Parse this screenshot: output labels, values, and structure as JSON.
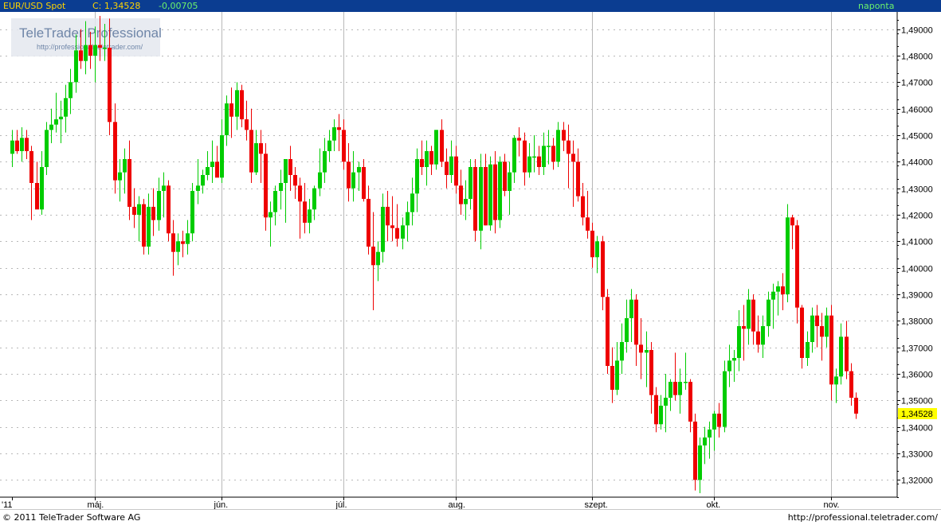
{
  "header": {
    "symbol": "EUR/USD Spot",
    "close_label": "C: 1,34528",
    "change": "-0,00705",
    "period": "naponta"
  },
  "watermark": {
    "title": "TeleTrader Professional",
    "url": "http://professional.teletrader.com/"
  },
  "footer": {
    "copyright": "© 2011 TeleTrader Software AG",
    "site": "http://professional.teletrader.com/"
  },
  "colors": {
    "up": "#00cc00",
    "down": "#ee0000",
    "header_bg": "#0b3d91",
    "last_price_bg": "#ffff00"
  },
  "chart_data": {
    "type": "candlestick",
    "title": "EUR/USD Spot",
    "yaxis_position": "right",
    "ylim": [
      1.3135,
      1.4965
    ],
    "y_ticks": [
      1.32,
      1.33,
      1.34,
      1.35,
      1.36,
      1.37,
      1.38,
      1.39,
      1.4,
      1.41,
      1.42,
      1.43,
      1.44,
      1.45,
      1.46,
      1.47,
      1.48,
      1.49
    ],
    "y_tick_labels": [
      "1,32000",
      "1,33000",
      "1,34000",
      "1,35000",
      "1,36000",
      "1,37000",
      "1,38000",
      "1,39000",
      "1,40000",
      "1,41000",
      "1,42000",
      "1,43000",
      "1,44000",
      "1,45000",
      "1,46000",
      "1,47000",
      "1,48000",
      "1,49000"
    ],
    "x_months": [
      {
        "label": "'11",
        "index": 0
      },
      {
        "label": "máj.",
        "index": 17
      },
      {
        "label": "jún.",
        "index": 43
      },
      {
        "label": "júl.",
        "index": 68
      },
      {
        "label": "aug.",
        "index": 91
      },
      {
        "label": "szept.",
        "index": 119
      },
      {
        "label": "okt.",
        "index": 144
      },
      {
        "label": "nov.",
        "index": 168
      }
    ],
    "last_price": "1,34528",
    "candles": [
      [
        1.443,
        1.452,
        1.438,
        1.448
      ],
      [
        1.448,
        1.452,
        1.443,
        1.444
      ],
      [
        1.444,
        1.453,
        1.44,
        1.449
      ],
      [
        1.449,
        1.452,
        1.441,
        1.444
      ],
      [
        1.444,
        1.446,
        1.418,
        1.432
      ],
      [
        1.432,
        1.44,
        1.425,
        1.422
      ],
      [
        1.422,
        1.444,
        1.42,
        1.438
      ],
      [
        1.438,
        1.455,
        1.435,
        1.452
      ],
      [
        1.452,
        1.46,
        1.447,
        1.454
      ],
      [
        1.454,
        1.466,
        1.451,
        1.456
      ],
      [
        1.456,
        1.463,
        1.447,
        1.457
      ],
      [
        1.457,
        1.469,
        1.451,
        1.464
      ],
      [
        1.464,
        1.475,
        1.458,
        1.47
      ],
      [
        1.47,
        1.488,
        1.466,
        1.482
      ],
      [
        1.482,
        1.49,
        1.475,
        1.478
      ],
      [
        1.478,
        1.493,
        1.473,
        1.484
      ],
      [
        1.484,
        1.489,
        1.475,
        1.48
      ],
      [
        1.48,
        1.491,
        1.47,
        1.484
      ],
      [
        1.484,
        1.495,
        1.478,
        1.483
      ],
      [
        1.483,
        1.492,
        1.478,
        1.483
      ],
      [
        1.483,
        1.494,
        1.45,
        1.455
      ],
      [
        1.455,
        1.462,
        1.428,
        1.433
      ],
      [
        1.433,
        1.441,
        1.425,
        1.436
      ],
      [
        1.436,
        1.445,
        1.428,
        1.441
      ],
      [
        1.441,
        1.448,
        1.418,
        1.423
      ],
      [
        1.423,
        1.43,
        1.415,
        1.42
      ],
      [
        1.42,
        1.427,
        1.41,
        1.424
      ],
      [
        1.424,
        1.426,
        1.405,
        1.408
      ],
      [
        1.408,
        1.428,
        1.405,
        1.423
      ],
      [
        1.423,
        1.43,
        1.412,
        1.418
      ],
      [
        1.418,
        1.434,
        1.414,
        1.429
      ],
      [
        1.429,
        1.436,
        1.419,
        1.431
      ],
      [
        1.431,
        1.433,
        1.41,
        1.413
      ],
      [
        1.413,
        1.418,
        1.397,
        1.406
      ],
      [
        1.406,
        1.413,
        1.401,
        1.41
      ],
      [
        1.41,
        1.414,
        1.404,
        1.409
      ],
      [
        1.409,
        1.418,
        1.405,
        1.413
      ],
      [
        1.413,
        1.432,
        1.41,
        1.429
      ],
      [
        1.429,
        1.441,
        1.424,
        1.431
      ],
      [
        1.431,
        1.437,
        1.428,
        1.435
      ],
      [
        1.435,
        1.444,
        1.433,
        1.438
      ],
      [
        1.438,
        1.448,
        1.432,
        1.44
      ],
      [
        1.44,
        1.446,
        1.435,
        1.434
      ],
      [
        1.434,
        1.456,
        1.432,
        1.45
      ],
      [
        1.45,
        1.465,
        1.446,
        1.462
      ],
      [
        1.462,
        1.468,
        1.449,
        1.457
      ],
      [
        1.457,
        1.47,
        1.452,
        1.467
      ],
      [
        1.467,
        1.469,
        1.453,
        1.456
      ],
      [
        1.456,
        1.463,
        1.448,
        1.452
      ],
      [
        1.452,
        1.46,
        1.432,
        1.436
      ],
      [
        1.436,
        1.452,
        1.435,
        1.447
      ],
      [
        1.447,
        1.452,
        1.432,
        1.443
      ],
      [
        1.443,
        1.447,
        1.414,
        1.419
      ],
      [
        1.419,
        1.425,
        1.408,
        1.421
      ],
      [
        1.421,
        1.431,
        1.416,
        1.429
      ],
      [
        1.429,
        1.437,
        1.422,
        1.432
      ],
      [
        1.432,
        1.44,
        1.417,
        1.441
      ],
      [
        1.441,
        1.446,
        1.429,
        1.435
      ],
      [
        1.435,
        1.438,
        1.426,
        1.431
      ],
      [
        1.431,
        1.434,
        1.411,
        1.425
      ],
      [
        1.425,
        1.432,
        1.413,
        1.417
      ],
      [
        1.417,
        1.426,
        1.413,
        1.422
      ],
      [
        1.422,
        1.431,
        1.418,
        1.43
      ],
      [
        1.43,
        1.445,
        1.427,
        1.436
      ],
      [
        1.436,
        1.449,
        1.432,
        1.444
      ],
      [
        1.444,
        1.452,
        1.44,
        1.448
      ],
      [
        1.448,
        1.456,
        1.444,
        1.453
      ],
      [
        1.453,
        1.458,
        1.444,
        1.452
      ],
      [
        1.452,
        1.456,
        1.437,
        1.44
      ],
      [
        1.44,
        1.447,
        1.425,
        1.43
      ],
      [
        1.43,
        1.444,
        1.425,
        1.436
      ],
      [
        1.436,
        1.44,
        1.429,
        1.438
      ],
      [
        1.438,
        1.441,
        1.425,
        1.426
      ],
      [
        1.426,
        1.431,
        1.405,
        1.408
      ],
      [
        1.408,
        1.421,
        1.384,
        1.401
      ],
      [
        1.401,
        1.41,
        1.395,
        1.406
      ],
      [
        1.406,
        1.428,
        1.402,
        1.423
      ],
      [
        1.423,
        1.429,
        1.41,
        1.416
      ],
      [
        1.416,
        1.427,
        1.41,
        1.415
      ],
      [
        1.415,
        1.424,
        1.408,
        1.411
      ],
      [
        1.411,
        1.419,
        1.407,
        1.416
      ],
      [
        1.416,
        1.425,
        1.41,
        1.421
      ],
      [
        1.421,
        1.434,
        1.416,
        1.428
      ],
      [
        1.428,
        1.445,
        1.421,
        1.441
      ],
      [
        1.441,
        1.448,
        1.435,
        1.438
      ],
      [
        1.438,
        1.448,
        1.431,
        1.444
      ],
      [
        1.444,
        1.446,
        1.435,
        1.439
      ],
      [
        1.439,
        1.452,
        1.437,
        1.452
      ],
      [
        1.452,
        1.456,
        1.438,
        1.44
      ],
      [
        1.44,
        1.445,
        1.43,
        1.435
      ],
      [
        1.435,
        1.448,
        1.432,
        1.442
      ],
      [
        1.442,
        1.446,
        1.428,
        1.431
      ],
      [
        1.431,
        1.437,
        1.42,
        1.424
      ],
      [
        1.424,
        1.433,
        1.418,
        1.426
      ],
      [
        1.426,
        1.441,
        1.422,
        1.438
      ],
      [
        1.438,
        1.441,
        1.41,
        1.414
      ],
      [
        1.414,
        1.443,
        1.407,
        1.438
      ],
      [
        1.438,
        1.443,
        1.416,
        1.416
      ],
      [
        1.416,
        1.442,
        1.414,
        1.439
      ],
      [
        1.439,
        1.444,
        1.413,
        1.418
      ],
      [
        1.418,
        1.442,
        1.415,
        1.44
      ],
      [
        1.44,
        1.443,
        1.427,
        1.429
      ],
      [
        1.429,
        1.44,
        1.42,
        1.436
      ],
      [
        1.436,
        1.45,
        1.432,
        1.449
      ],
      [
        1.449,
        1.453,
        1.442,
        1.448
      ],
      [
        1.448,
        1.451,
        1.431,
        1.436
      ],
      [
        1.436,
        1.447,
        1.434,
        1.442
      ],
      [
        1.442,
        1.45,
        1.436,
        1.442
      ],
      [
        1.442,
        1.446,
        1.435,
        1.438
      ],
      [
        1.438,
        1.451,
        1.435,
        1.446
      ],
      [
        1.446,
        1.452,
        1.439,
        1.446
      ],
      [
        1.446,
        1.449,
        1.437,
        1.44
      ],
      [
        1.44,
        1.455,
        1.438,
        1.452
      ],
      [
        1.452,
        1.455,
        1.444,
        1.448
      ],
      [
        1.448,
        1.454,
        1.43,
        1.443
      ],
      [
        1.443,
        1.448,
        1.423,
        1.44
      ],
      [
        1.44,
        1.445,
        1.425,
        1.427
      ],
      [
        1.427,
        1.432,
        1.416,
        1.419
      ],
      [
        1.419,
        1.429,
        1.411,
        1.414
      ],
      [
        1.414,
        1.417,
        1.4,
        1.404
      ],
      [
        1.404,
        1.412,
        1.398,
        1.41
      ],
      [
        1.41,
        1.412,
        1.384,
        1.389
      ],
      [
        1.389,
        1.392,
        1.36,
        1.363
      ],
      [
        1.363,
        1.37,
        1.349,
        1.354
      ],
      [
        1.354,
        1.372,
        1.352,
        1.365
      ],
      [
        1.365,
        1.379,
        1.36,
        1.372
      ],
      [
        1.372,
        1.388,
        1.368,
        1.381
      ],
      [
        1.381,
        1.392,
        1.372,
        1.388
      ],
      [
        1.388,
        1.39,
        1.363,
        1.371
      ],
      [
        1.371,
        1.381,
        1.358,
        1.368
      ],
      [
        1.368,
        1.376,
        1.355,
        1.369
      ],
      [
        1.369,
        1.372,
        1.345,
        1.352
      ],
      [
        1.352,
        1.355,
        1.338,
        1.341
      ],
      [
        1.341,
        1.352,
        1.339,
        1.348
      ],
      [
        1.348,
        1.36,
        1.338,
        1.351
      ],
      [
        1.351,
        1.358,
        1.346,
        1.357
      ],
      [
        1.357,
        1.368,
        1.35,
        1.352
      ],
      [
        1.352,
        1.362,
        1.345,
        1.357
      ],
      [
        1.357,
        1.368,
        1.354,
        1.357
      ],
      [
        1.357,
        1.358,
        1.338,
        1.342
      ],
      [
        1.342,
        1.345,
        1.316,
        1.32
      ],
      [
        1.32,
        1.336,
        1.315,
        1.333
      ],
      [
        1.333,
        1.34,
        1.326,
        1.336
      ],
      [
        1.336,
        1.342,
        1.328,
        1.339
      ],
      [
        1.339,
        1.346,
        1.331,
        1.345
      ],
      [
        1.345,
        1.349,
        1.336,
        1.34
      ],
      [
        1.34,
        1.365,
        1.338,
        1.361
      ],
      [
        1.361,
        1.371,
        1.355,
        1.365
      ],
      [
        1.365,
        1.369,
        1.357,
        1.366
      ],
      [
        1.366,
        1.384,
        1.361,
        1.378
      ],
      [
        1.378,
        1.386,
        1.365,
        1.377
      ],
      [
        1.377,
        1.392,
        1.371,
        1.388
      ],
      [
        1.388,
        1.39,
        1.371,
        1.376
      ],
      [
        1.376,
        1.382,
        1.368,
        1.371
      ],
      [
        1.371,
        1.382,
        1.366,
        1.378
      ],
      [
        1.378,
        1.391,
        1.374,
        1.388
      ],
      [
        1.388,
        1.394,
        1.377,
        1.391
      ],
      [
        1.391,
        1.395,
        1.382,
        1.393
      ],
      [
        1.393,
        1.398,
        1.384,
        1.39
      ],
      [
        1.39,
        1.424,
        1.387,
        1.419
      ],
      [
        1.419,
        1.42,
        1.407,
        1.416
      ],
      [
        1.416,
        1.418,
        1.379,
        1.385
      ],
      [
        1.385,
        1.386,
        1.362,
        1.366
      ],
      [
        1.366,
        1.376,
        1.363,
        1.372
      ],
      [
        1.372,
        1.385,
        1.368,
        1.382
      ],
      [
        1.382,
        1.386,
        1.37,
        1.378
      ],
      [
        1.378,
        1.383,
        1.365,
        1.374
      ],
      [
        1.374,
        1.385,
        1.37,
        1.382
      ],
      [
        1.382,
        1.386,
        1.35,
        1.356
      ],
      [
        1.356,
        1.362,
        1.349,
        1.359
      ],
      [
        1.359,
        1.379,
        1.356,
        1.374
      ],
      [
        1.374,
        1.38,
        1.358,
        1.361
      ],
      [
        1.361,
        1.364,
        1.348,
        1.351
      ],
      [
        1.351,
        1.353,
        1.343,
        1.345
      ]
    ]
  }
}
